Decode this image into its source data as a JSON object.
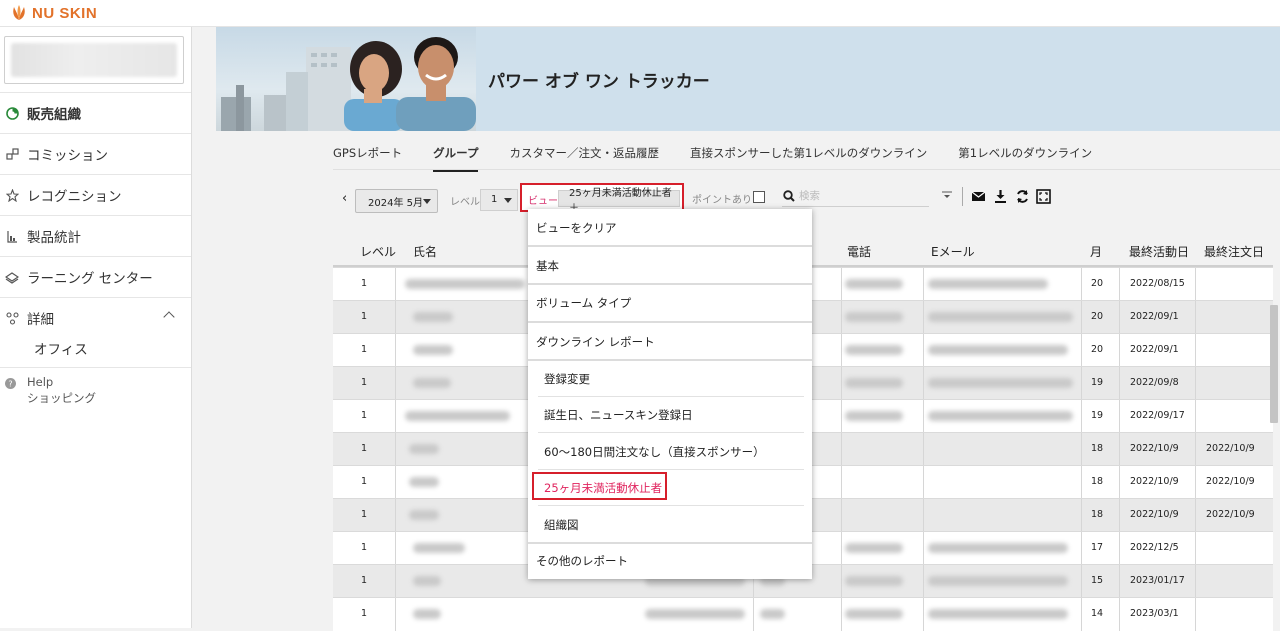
{
  "brand": {
    "name": "NU SKIN",
    "color": "#e2722a"
  },
  "sidebar": {
    "items": [
      {
        "label": "販売組織",
        "icon": "org-spiral-icon",
        "active": true
      },
      {
        "label": "コミッション",
        "icon": "commission-icon",
        "active": false
      },
      {
        "label": "レコグニション",
        "icon": "star-icon",
        "active": false
      },
      {
        "label": "製品統計",
        "icon": "product-stats-icon",
        "active": false
      },
      {
        "label": "ラーニング センター",
        "icon": "learning-icon",
        "active": false
      },
      {
        "label": "詳細",
        "icon": "details-icon",
        "active": false,
        "expanded": true
      }
    ],
    "sub_items": [
      "オフィス"
    ],
    "help": {
      "line1": "Help",
      "line2": "ショッピング"
    }
  },
  "hero": {
    "title": "パワー オブ ワン トラッカー"
  },
  "tabs": [
    {
      "label": "GPSレポート",
      "active": false
    },
    {
      "label": "グループ",
      "active": true
    },
    {
      "label": "カスタマー／注文・返品履歴",
      "active": false
    },
    {
      "label": "直接スポンサーした第1レベルのダウンライン",
      "active": false
    },
    {
      "label": "第1レベルのダウンライン",
      "active": false
    }
  ],
  "toolbar": {
    "prev": "‹",
    "month": "2024年 5月",
    "level_label": "レベル",
    "level_value": "1",
    "view_label": "ビュー",
    "view_chip": "25ヶ月未満活動休止者 ＋",
    "points_label": "ポイントあり",
    "search_placeholder": "検索"
  },
  "table": {
    "columns": [
      "レベル",
      "氏名",
      "電話",
      "Eメール",
      "月",
      "最終活動日",
      "最終注文日"
    ],
    "rows": [
      {
        "level": "1",
        "month": "20",
        "last_activity": "2022/08/15",
        "last_order": ""
      },
      {
        "level": "1",
        "month": "20",
        "last_activity": "2022/09/1",
        "last_order": ""
      },
      {
        "level": "1",
        "month": "20",
        "last_activity": "2022/09/1",
        "last_order": ""
      },
      {
        "level": "1",
        "month": "19",
        "last_activity": "2022/09/8",
        "last_order": ""
      },
      {
        "level": "1",
        "month": "19",
        "last_activity": "2022/09/17",
        "last_order": ""
      },
      {
        "level": "1",
        "month": "18",
        "last_activity": "2022/10/9",
        "last_order": "2022/10/9"
      },
      {
        "level": "1",
        "month": "18",
        "last_activity": "2022/10/9",
        "last_order": "2022/10/9"
      },
      {
        "level": "1",
        "month": "18",
        "last_activity": "2022/10/9",
        "last_order": "2022/10/9"
      },
      {
        "level": "1",
        "month": "17",
        "last_activity": "2022/12/5",
        "last_order": ""
      },
      {
        "level": "1",
        "month": "15",
        "last_activity": "2023/01/17",
        "last_order": ""
      },
      {
        "level": "1",
        "month": "14",
        "last_activity": "2023/03/1",
        "last_order": ""
      }
    ]
  },
  "view_menu": {
    "clear": "ビューをクリア",
    "basic": "基本",
    "volume": "ボリューム タイプ",
    "downline": "ダウンライン レポート",
    "downline_items": [
      "登録変更",
      "誕生日、ニュースキン登録日",
      "60～180日間注文なし（直接スポンサー）",
      "25ヶ月未満活動休止者",
      "組織図"
    ],
    "other": "その他のレポート",
    "highlight_color": "#e0245e"
  }
}
